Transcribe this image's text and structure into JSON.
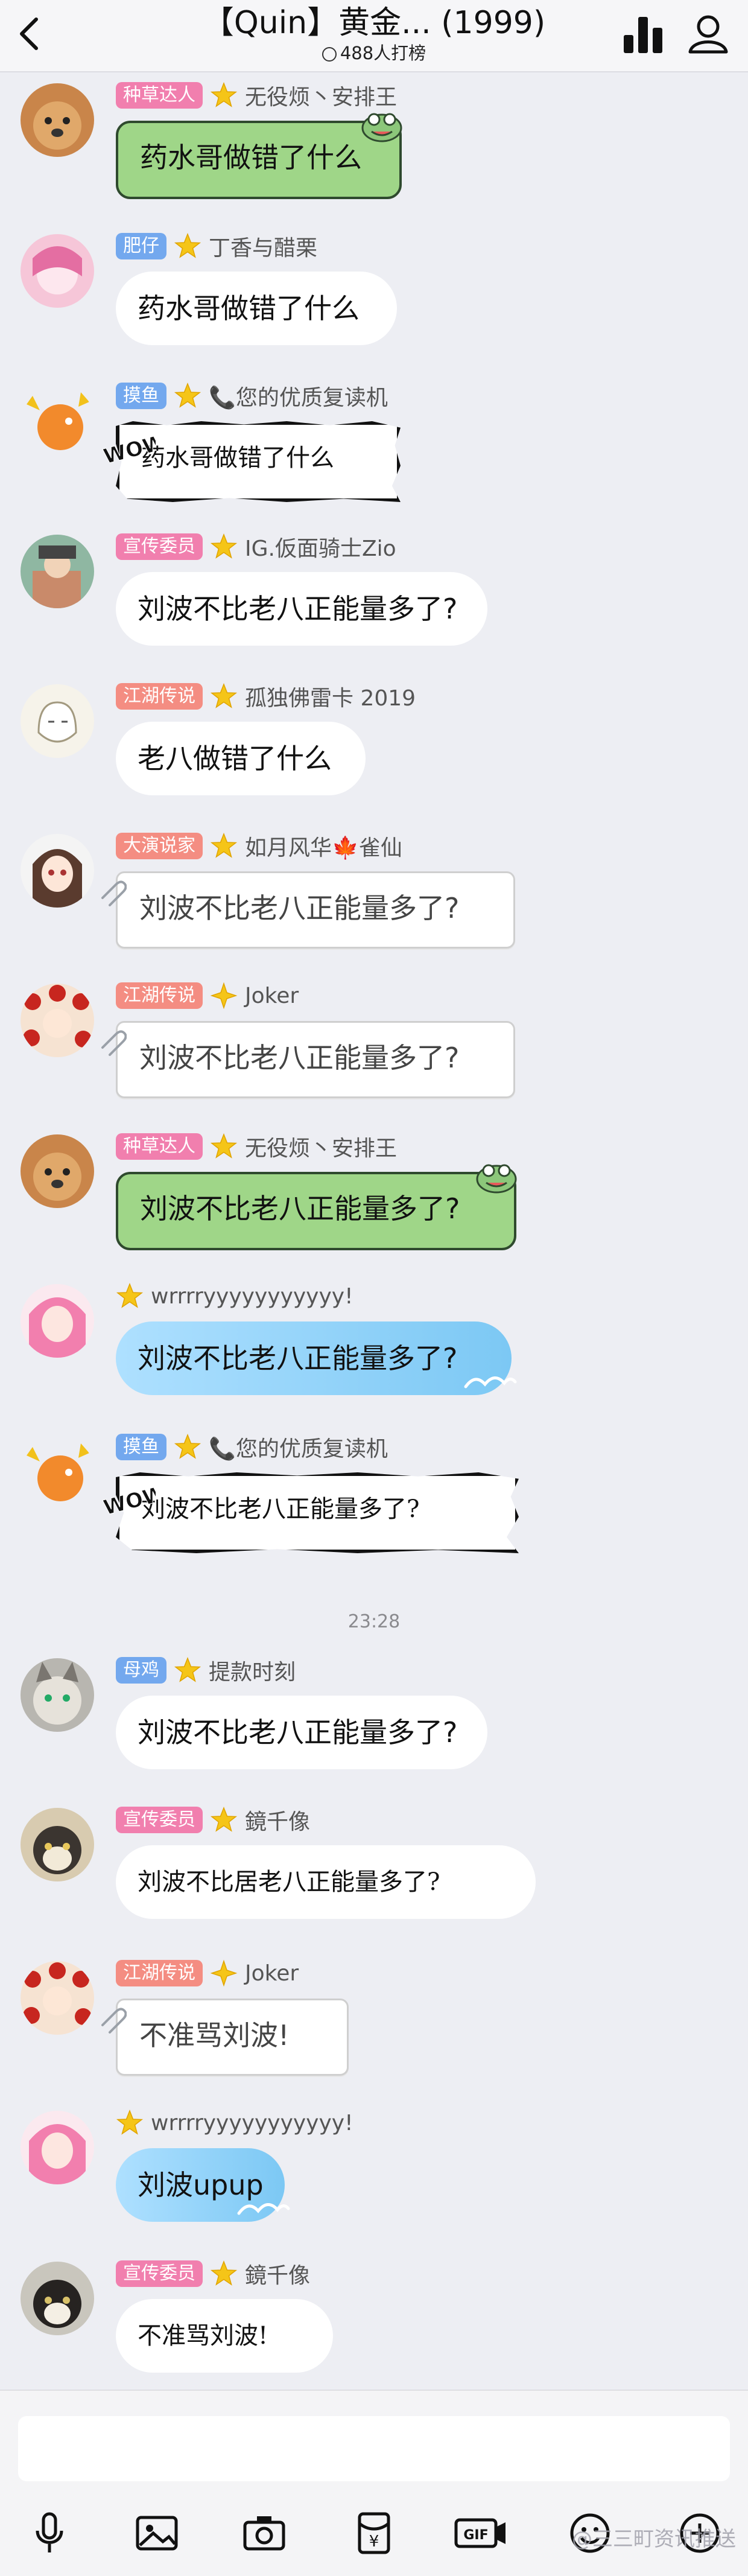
{
  "header": {
    "title": "【Quin】黄金... (1999)",
    "subtitle": "488人打榜"
  },
  "divider_time": "23:28",
  "messages": [
    {
      "badge": "种草达人",
      "badge_color": "#f17fae",
      "name": "无役烦丶安排王",
      "text": "药水哥做错了什么",
      "style": "green",
      "avatar": "dog"
    },
    {
      "badge": "肥仔",
      "badge_color": "#73a8ee",
      "name": "丁香与醋栗",
      "text": "药水哥做错了什么",
      "style": "white",
      "avatar": "pink"
    },
    {
      "badge": "摸鱼",
      "badge_color": "#73a8ee",
      "name": "📞您的优质复读机",
      "text": "药水哥做错了什么",
      "style": "comic",
      "avatar": "dragon"
    },
    {
      "badge": "宣传委员",
      "badge_color": "#f17fae",
      "name": "IG.仮面骑士Zio",
      "text": "刘波不比老八正能量多了?",
      "style": "white",
      "avatar": "photo"
    },
    {
      "badge": "江湖传说",
      "badge_color": "#f48d82",
      "name": "孤独佛雷卡 2019",
      "text": "老八做错了什么",
      "style": "white",
      "avatar": "sketch"
    },
    {
      "badge": "大演说家",
      "badge_color": "#f48d82",
      "name": "如月风华🍁雀仙",
      "text": "刘波不比老八正能量多了?",
      "style": "paper",
      "avatar": "anime"
    },
    {
      "badge": "江湖传说",
      "badge_color": "#f48d82",
      "name": "Joker",
      "text": "刘波不比老八正能量多了?",
      "style": "paper",
      "avatar": "flower",
      "diamond": true
    },
    {
      "badge": "种草达人",
      "badge_color": "#f17fae",
      "name": "无役烦丶安排王",
      "text": "刘波不比老八正能量多了?",
      "style": "green",
      "avatar": "dog"
    },
    {
      "badge": "",
      "badge_color": "",
      "name": "wrrrryyyyyyyyyyy!",
      "text": "刘波不比老八正能量多了?",
      "style": "blue",
      "avatar": "pinkhair"
    },
    {
      "badge": "摸鱼",
      "badge_color": "#73a8ee",
      "name": "📞您的优质复读机",
      "text": "刘波不比老八正能量多了?",
      "style": "comic",
      "avatar": "dragon"
    },
    {
      "badge": "母鸡",
      "badge_color": "#73a8ee",
      "name": "提款时刻",
      "text": "刘波不比老八正能量多了?",
      "style": "white",
      "avatar": "cat"
    },
    {
      "badge": "宣传委员",
      "badge_color": "#f17fae",
      "name": "鏡千像",
      "text": "刘波不比居老八正能量多了?",
      "style": "serif",
      "avatar": "cat2"
    },
    {
      "badge": "江湖传说",
      "badge_color": "#f48d82",
      "name": "Joker",
      "text": "不准骂刘波!",
      "style": "paper",
      "avatar": "flower",
      "diamond": true
    },
    {
      "badge": "",
      "badge_color": "",
      "name": "wrrrryyyyyyyyyyy!",
      "text": "刘波upup",
      "style": "blue",
      "avatar": "pinkhair"
    },
    {
      "badge": "宣传委员",
      "badge_color": "#f17fae",
      "name": "鏡千像",
      "text": "不准骂刘波!",
      "style": "serif",
      "avatar": "cat3"
    }
  ],
  "toolbar": {
    "icons": [
      "microphone-icon",
      "image-icon",
      "camera-icon",
      "red-packet-icon",
      "gif-icon",
      "emoji-icon",
      "plus-icon"
    ]
  },
  "watermark": "@三三町资讯推送"
}
